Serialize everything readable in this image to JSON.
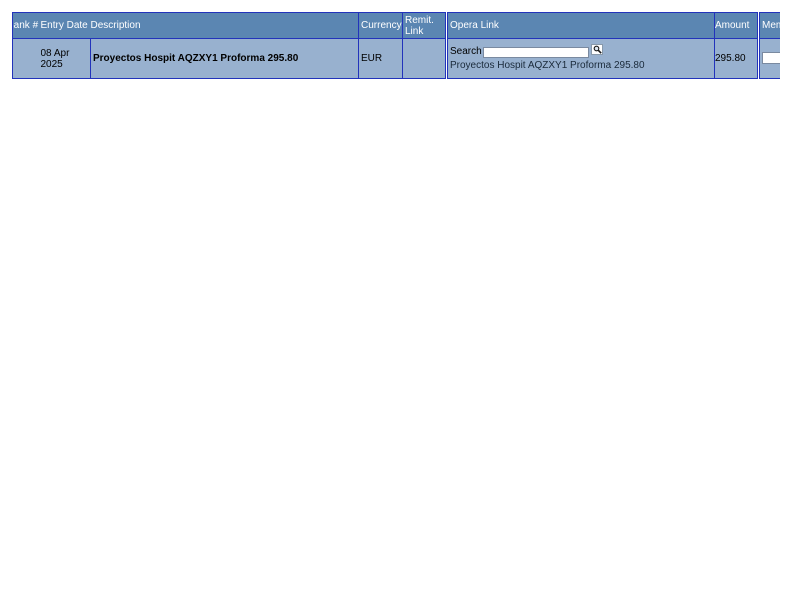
{
  "table": {
    "headers": {
      "rank": "Bank #",
      "entry_date": "Entry Date",
      "description": "Description",
      "currency": "Currency",
      "remit_link": "Remit. Link",
      "opera_link": "Opera Link",
      "amount": "Amount",
      "memo": "Memo"
    },
    "rows": [
      {
        "rank": "",
        "entry_date": "08 Apr 2025",
        "description": "Proyectos Hospit AQZXY1 Proforma 295.80",
        "currency": "EUR",
        "remit_link": "",
        "search_label": "Search",
        "search_value": "",
        "opera_link_text": "Proyectos Hospit AQZXY1 Proforma 295.80",
        "amount": "295.80",
        "memo_value": ""
      }
    ]
  },
  "icons": {
    "search_button": "magnifier-icon"
  }
}
